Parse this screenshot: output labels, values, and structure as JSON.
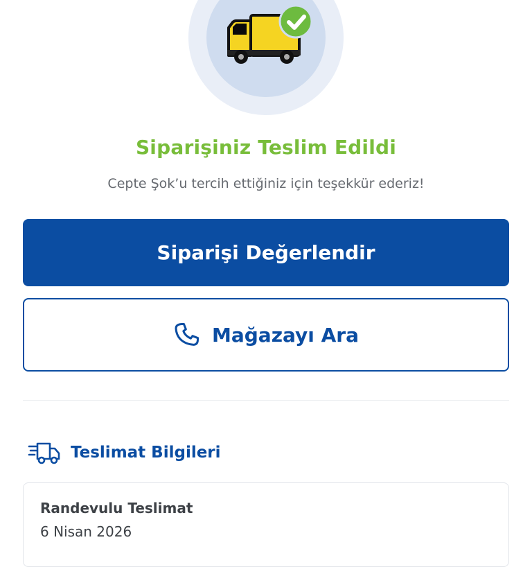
{
  "status": {
    "title": "Siparişiniz Teslim Edildi",
    "message": "Cepte Şok’u tercih ettiğiniz için teşekkür ederiz!",
    "icon": "delivery-truck-check-icon"
  },
  "actions": {
    "rate_order_label": "Siparişi Değerlendir",
    "call_store_label": "Mağazayı Ara",
    "call_icon": "phone-icon"
  },
  "delivery_info": {
    "section_title": "Teslimat Bilgileri",
    "section_icon": "fast-delivery-truck-icon",
    "type": "Randevulu Teslimat",
    "date": "6 Nisan 2026"
  },
  "colors": {
    "brand_blue": "#0b4da2",
    "success_green": "#78bd3a",
    "truck_yellow": "#f5d422"
  }
}
